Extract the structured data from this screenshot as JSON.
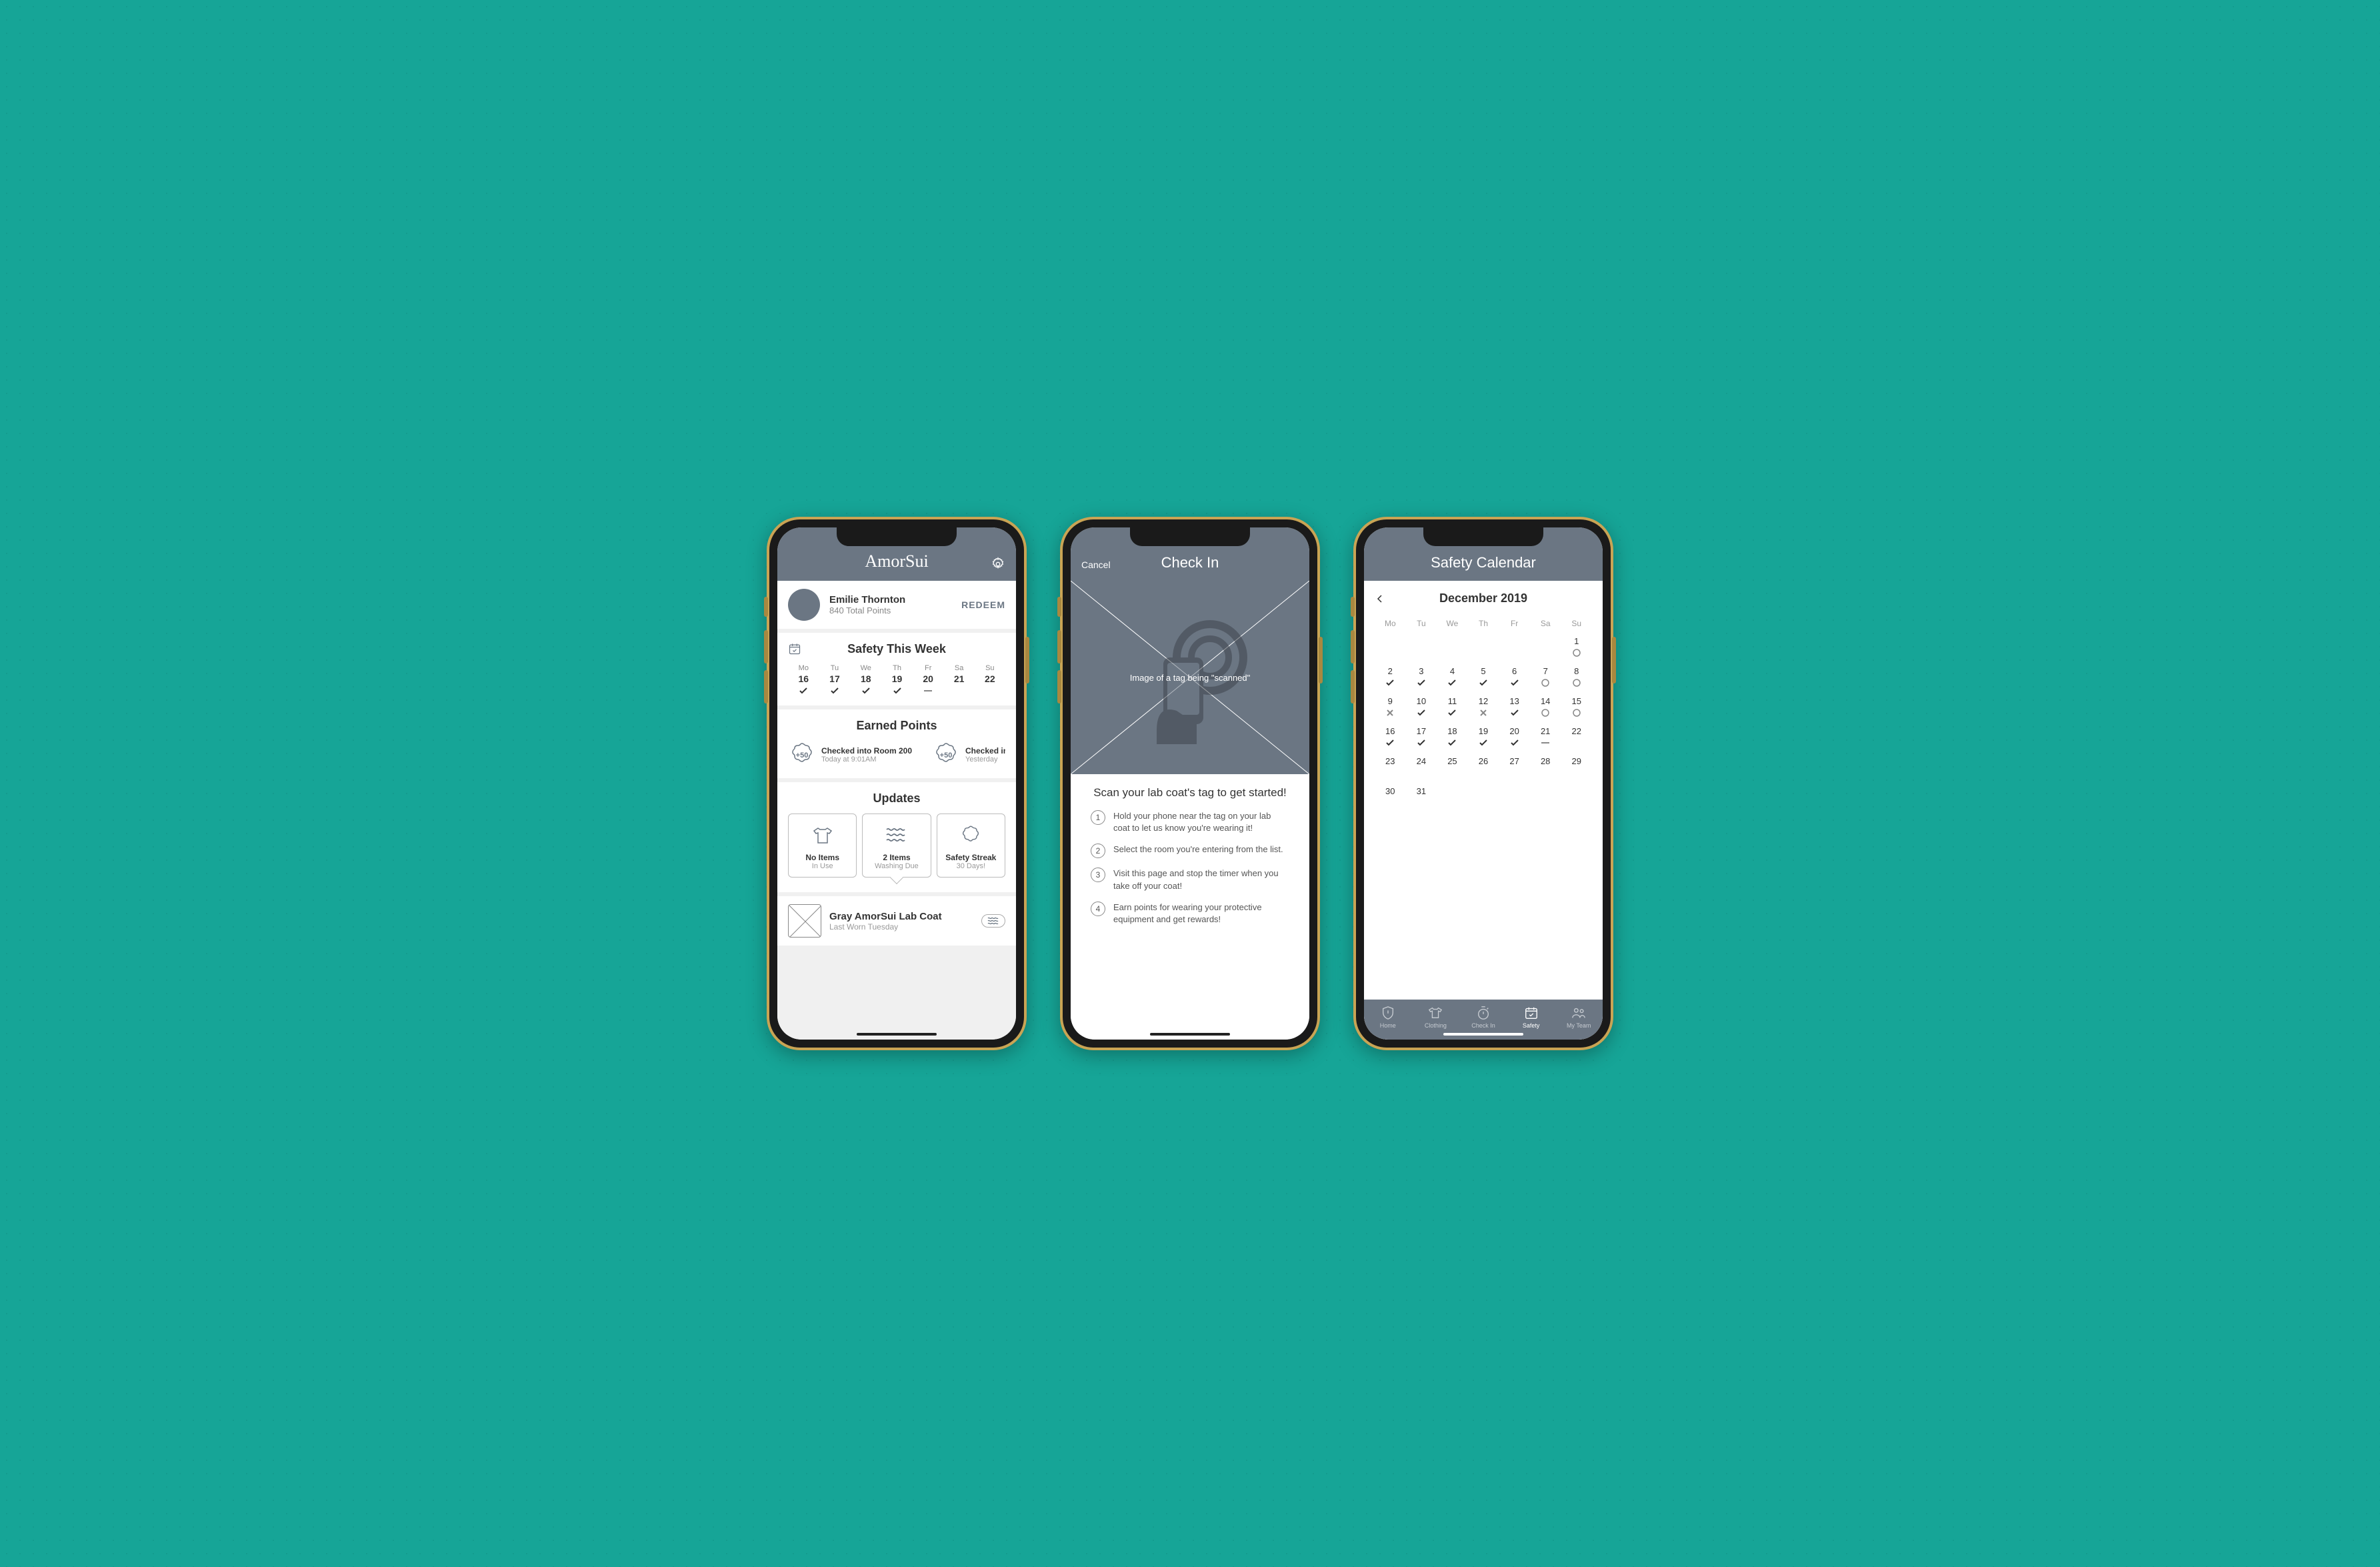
{
  "screen1": {
    "app_title": "AmorSui",
    "user_name": "Emilie Thornton",
    "points_line": "840 Total Points",
    "redeem_label": "REDEEM",
    "safety_title": "Safety This Week",
    "week": [
      {
        "dow": "Mo",
        "date": "16",
        "status": "check"
      },
      {
        "dow": "Tu",
        "date": "17",
        "status": "check"
      },
      {
        "dow": "We",
        "date": "18",
        "status": "check"
      },
      {
        "dow": "Th",
        "date": "19",
        "status": "check"
      },
      {
        "dow": "Fr",
        "date": "20",
        "status": "dash"
      },
      {
        "dow": "Sa",
        "date": "21",
        "status": "none"
      },
      {
        "dow": "Su",
        "date": "22",
        "status": "none"
      }
    ],
    "earned_title": "Earned Points",
    "earned_items": [
      {
        "badge": "+50",
        "title": "Checked into Room 200",
        "sub": "Today at 9:01AM"
      },
      {
        "badge": "+50",
        "title": "Checked in",
        "sub": "Yesterday"
      }
    ],
    "updates_title": "Updates",
    "update_cards": [
      {
        "icon": "shirt",
        "title": "No Items",
        "sub": "In Use"
      },
      {
        "icon": "waves",
        "title": "2 Items",
        "sub": "Washing Due"
      },
      {
        "icon": "badge",
        "title": "Safety Streak",
        "sub": "30 Days!"
      }
    ],
    "item_name": "Gray AmorSui Lab Coat",
    "item_sub": "Last Worn Tuesday"
  },
  "screen2": {
    "cancel_label": "Cancel",
    "title": "Check In",
    "image_caption": "Image of a tag being \"scanned\"",
    "heading": "Scan your lab coat's tag to get started!",
    "steps": [
      "Hold your phone near the tag on your lab coat to let us know you're wearing it!",
      "Select the room you're entering from the list.",
      "Visit this page and stop the timer when you take off your coat!",
      "Earn points for wearing your protective equipment and get rewards!"
    ]
  },
  "screen3": {
    "title": "Safety Calendar",
    "month_label": "December 2019",
    "dows": [
      "Mo",
      "Tu",
      "We",
      "Th",
      "Fr",
      "Sa",
      "Su"
    ],
    "weeks": [
      [
        null,
        null,
        null,
        null,
        null,
        null,
        {
          "d": "1",
          "s": "circle"
        }
      ],
      [
        {
          "d": "2",
          "s": "check"
        },
        {
          "d": "3",
          "s": "check"
        },
        {
          "d": "4",
          "s": "check"
        },
        {
          "d": "5",
          "s": "check"
        },
        {
          "d": "6",
          "s": "check"
        },
        {
          "d": "7",
          "s": "circle"
        },
        {
          "d": "8",
          "s": "circle"
        }
      ],
      [
        {
          "d": "9",
          "s": "x"
        },
        {
          "d": "10",
          "s": "check"
        },
        {
          "d": "11",
          "s": "check"
        },
        {
          "d": "12",
          "s": "x"
        },
        {
          "d": "13",
          "s": "check"
        },
        {
          "d": "14",
          "s": "circle"
        },
        {
          "d": "15",
          "s": "circle"
        }
      ],
      [
        {
          "d": "16",
          "s": "check"
        },
        {
          "d": "17",
          "s": "check"
        },
        {
          "d": "18",
          "s": "check"
        },
        {
          "d": "19",
          "s": "check"
        },
        {
          "d": "20",
          "s": "check"
        },
        {
          "d": "21",
          "s": "dash"
        },
        {
          "d": "22",
          "s": "none"
        }
      ],
      [
        {
          "d": "23",
          "s": "none"
        },
        {
          "d": "24",
          "s": "none"
        },
        {
          "d": "25",
          "s": "none"
        },
        {
          "d": "26",
          "s": "none"
        },
        {
          "d": "27",
          "s": "none"
        },
        {
          "d": "28",
          "s": "none"
        },
        {
          "d": "29",
          "s": "none"
        }
      ],
      [
        {
          "d": "30",
          "s": "none"
        },
        {
          "d": "31",
          "s": "none"
        },
        null,
        null,
        null,
        null,
        null
      ]
    ],
    "tabs": [
      {
        "icon": "shield",
        "label": "Home"
      },
      {
        "icon": "shirt",
        "label": "Clothing"
      },
      {
        "icon": "timer",
        "label": "Check In"
      },
      {
        "icon": "calendar",
        "label": "Safety"
      },
      {
        "icon": "team",
        "label": "My Team"
      }
    ],
    "active_tab": 3
  }
}
